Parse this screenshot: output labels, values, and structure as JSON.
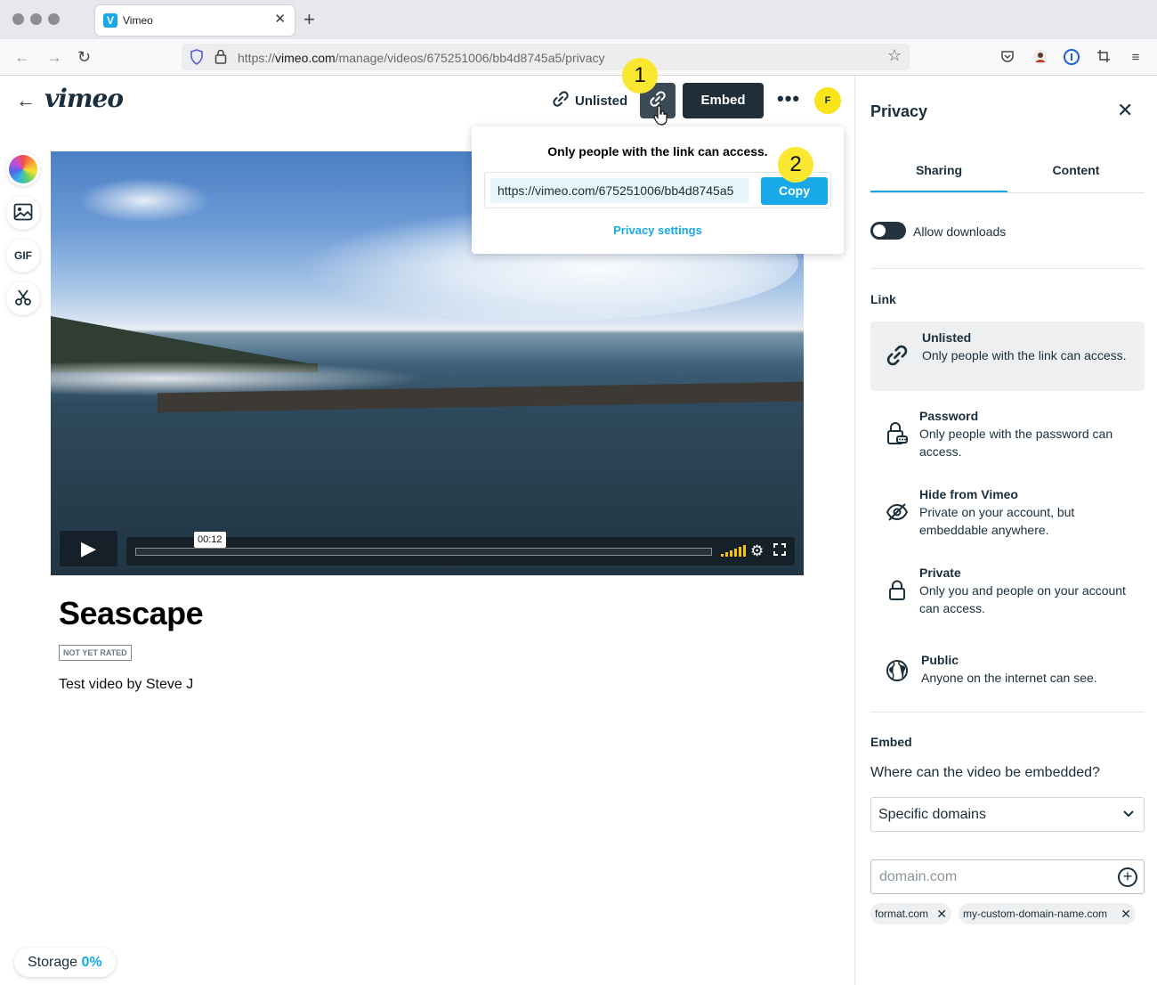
{
  "browser": {
    "tab_title": "Vimeo",
    "tab_favicon": "V",
    "url_prefix": "https://",
    "url_host": "vimeo.com",
    "url_path": "/manage/videos/675251006/bb4d8745a5/privacy"
  },
  "header": {
    "logo": "vimeo",
    "unlisted_label": "Unlisted",
    "embed_label": "Embed",
    "more_label": "•••",
    "avatar_initial": "F"
  },
  "badges": {
    "one": "1",
    "two": "2"
  },
  "tools": {
    "gif_label": "GIF"
  },
  "player": {
    "time": "00:12",
    "progress": 0.0
  },
  "video": {
    "title": "Seascape",
    "rating": "NOT YET RATED",
    "description": "Test video by Steve J"
  },
  "storage": {
    "label": "Storage",
    "percent": "0%"
  },
  "popover": {
    "text": "Only people with the link can access.",
    "url": "https://vimeo.com/675251006/bb4d8745a5",
    "copy_label": "Copy",
    "settings_link": "Privacy settings"
  },
  "panel": {
    "title": "Privacy",
    "tabs": [
      {
        "label": "Sharing",
        "active": true
      },
      {
        "label": "Content",
        "active": false
      }
    ],
    "allow_downloads_label": "Allow downloads",
    "allow_downloads_on": false,
    "link_section": "Link",
    "options": [
      {
        "title": "Unlisted",
        "desc": "Only people with the link can access.",
        "icon": "link-icon",
        "selected": true
      },
      {
        "title": "Password",
        "desc": "Only people with the password can access.",
        "icon": "password-lock-icon",
        "selected": false
      },
      {
        "title": "Hide from Vimeo",
        "desc": "Private on your account, but embeddable anywhere.",
        "icon": "eye-off-icon",
        "selected": false
      },
      {
        "title": "Private",
        "desc": "Only you and people on your account can access.",
        "icon": "lock-icon",
        "selected": false
      },
      {
        "title": "Public",
        "desc": "Anyone on the internet can see.",
        "icon": "globe-icon",
        "selected": false
      }
    ],
    "embed_section": "Embed",
    "embed_question": "Where can the video be embedded?",
    "embed_select": "Specific domains",
    "domain_placeholder": "domain.com",
    "domains": [
      "format.com",
      "my-custom-domain-name.com"
    ]
  },
  "colors": {
    "accent": "#17a9e8",
    "dark": "#1f2e38",
    "badge": "#fae72f"
  }
}
